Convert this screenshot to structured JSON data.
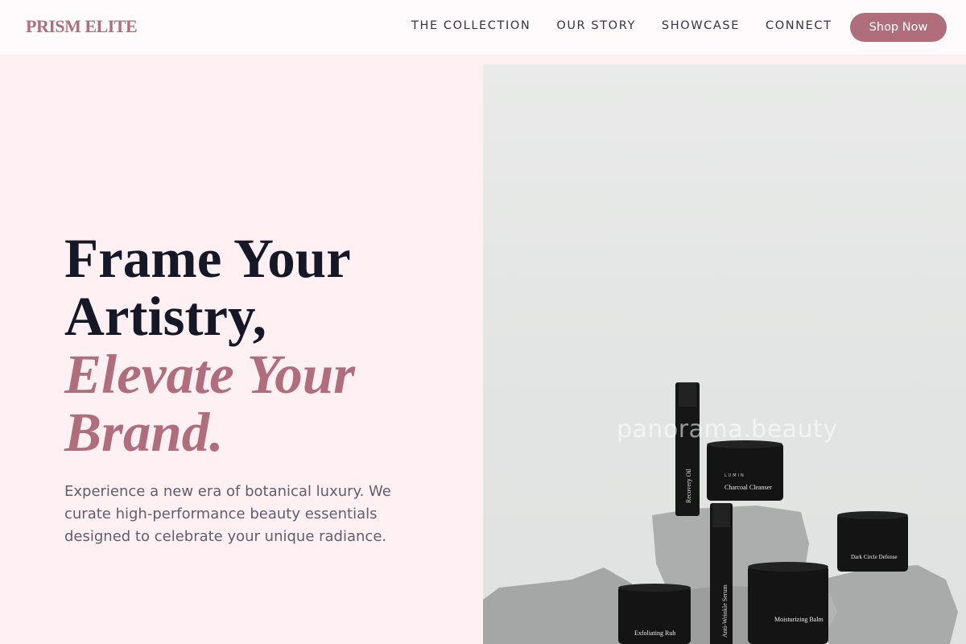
{
  "header": {
    "logo": "PRISM ELITE",
    "nav": [
      {
        "label": "THE COLLECTION"
      },
      {
        "label": "OUR STORY"
      },
      {
        "label": "SHOWCASE"
      },
      {
        "label": "CONNECT"
      }
    ],
    "cta": "Shop Now"
  },
  "hero": {
    "line1": "Frame Your",
    "line2": "Artistry,",
    "accent1": "Elevate Your",
    "accent2": "Brand.",
    "description": "Experience a new era of botanical luxury. We curate high-performance beauty essentials designed to celebrate your unique radiance."
  },
  "image": {
    "watermark": "panorama.beauty",
    "brand": "LUMIN",
    "products": [
      {
        "name": "Recovery Oil"
      },
      {
        "name": "Charcoal Cleanser"
      },
      {
        "name": "Anti-Wrinkle Serum"
      },
      {
        "name": "Dark Circle Defense"
      },
      {
        "name": "Exfoliating Rub"
      },
      {
        "name": "Moisturizing Balm"
      }
    ]
  },
  "colors": {
    "accent": "#b06e7c",
    "background": "#fff0f4",
    "heading": "#151827"
  }
}
